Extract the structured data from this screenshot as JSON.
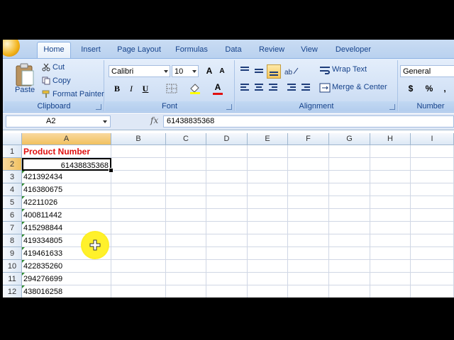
{
  "ribbon": {
    "tabs": [
      "Home",
      "Insert",
      "Page Layout",
      "Formulas",
      "Data",
      "Review",
      "View",
      "Developer"
    ],
    "clipboard": {
      "paste": "Paste",
      "cut": "Cut",
      "copy": "Copy",
      "format_painter": "Format Painter",
      "group": "Clipboard"
    },
    "font": {
      "name": "Calibri",
      "size": "10",
      "group": "Font",
      "bold": "B",
      "italic": "I",
      "underline": "U"
    },
    "alignment": {
      "wrap_text": "Wrap Text",
      "merge_center": "Merge & Center",
      "group": "Alignment"
    },
    "number": {
      "format": "General",
      "currency": "$",
      "percent": "%",
      "comma": ",",
      "group": "Number"
    }
  },
  "formula_bar": {
    "name_box": "A2",
    "fx": "fx",
    "content": "61438835368"
  },
  "grid": {
    "columns": [
      "A",
      "B",
      "C",
      "D",
      "E",
      "F",
      "G",
      "H",
      "I"
    ],
    "rows": [
      "1",
      "2",
      "3",
      "4",
      "5",
      "6",
      "7",
      "8",
      "9",
      "10",
      "11",
      "12"
    ],
    "header": "Product Number",
    "active_value": "61438835368",
    "values": [
      "421392434",
      "416380675",
      "42211026",
      "400811442",
      "415298844",
      "419334805",
      "419461633",
      "422835260",
      "294276699",
      "438016258"
    ]
  },
  "colors": {
    "header_text": "#e01010",
    "ribbon_text": "#15428b",
    "selected_header": "#f1c15f"
  }
}
